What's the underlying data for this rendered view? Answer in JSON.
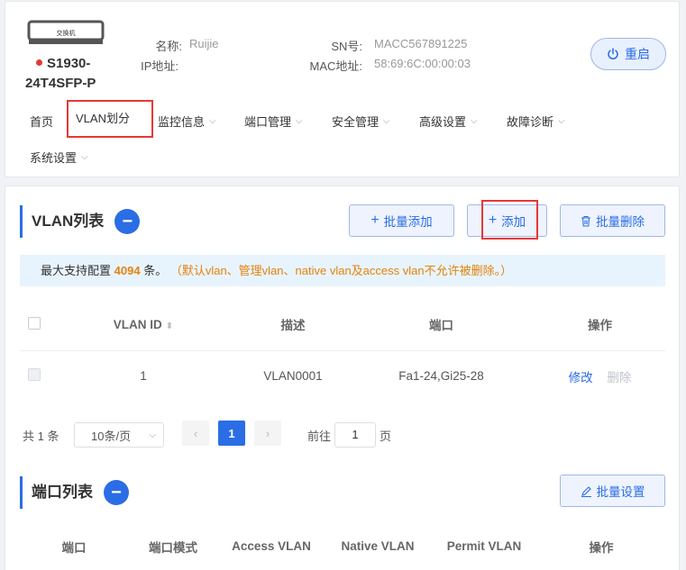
{
  "device": {
    "icon_label": "交换机",
    "model_line1": "S1930-",
    "model_line2": "24T4SFP-P",
    "name_label": "名称:",
    "name_value": "Ruijie",
    "ip_label": "IP地址:",
    "ip_value": "",
    "sn_label": "SN号:",
    "sn_value": "MACC567891225",
    "mac_label": "MAC地址:",
    "mac_value": "58:69:6C:00:00:03",
    "restart_label": "重启"
  },
  "nav": {
    "items": [
      {
        "label": "首页",
        "has_dropdown": false
      },
      {
        "label": "VLAN划分",
        "has_dropdown": false,
        "active": true
      },
      {
        "label": "监控信息",
        "has_dropdown": true
      },
      {
        "label": "端口管理",
        "has_dropdown": true
      },
      {
        "label": "安全管理",
        "has_dropdown": true
      },
      {
        "label": "高级设置",
        "has_dropdown": true
      },
      {
        "label": "故障诊断",
        "has_dropdown": true
      },
      {
        "label": "系统设置",
        "has_dropdown": true
      }
    ]
  },
  "vlan_section": {
    "title": "VLAN列表",
    "batch_add": "批量添加",
    "add": "添加",
    "batch_delete": "批量删除",
    "notice_prefix": "最大支持配置",
    "notice_max": "4094",
    "notice_suffix": "条。",
    "notice_warn": "（默认vlan、管理vlan、native vlan及access vlan不允许被删除。）",
    "columns": [
      "VLAN ID",
      "描述",
      "端口",
      "操作"
    ],
    "rows": [
      {
        "vlan_id": "1",
        "desc": "VLAN0001",
        "ports": "Fa1-24,Gi25-28",
        "edit": "修改",
        "delete": "删除"
      }
    ],
    "pager": {
      "total": "共 1 条",
      "page_size": "10条/页",
      "current": "1",
      "goto_label": "前往",
      "goto_value": "1",
      "page_unit": "页",
      "prev": "‹",
      "next": "›"
    }
  },
  "port_section": {
    "title": "端口列表",
    "batch_set": "批量设置",
    "columns": [
      "端口",
      "端口模式",
      "Access VLAN",
      "Native VLAN",
      "Permit VLAN",
      "操作"
    ]
  },
  "colors": {
    "accent": "#2b6de5",
    "highlight": "#e53935",
    "warning": "#e6820b"
  }
}
